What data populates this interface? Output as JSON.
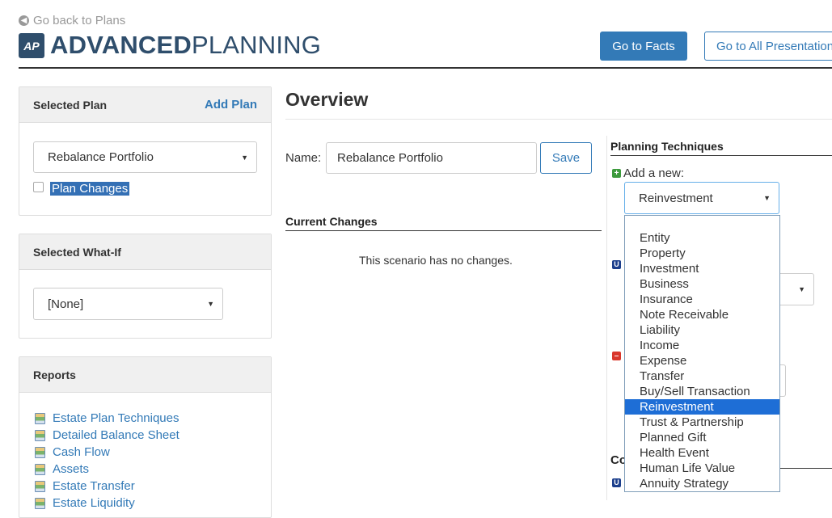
{
  "header": {
    "back_link": "Go back to Plans",
    "logo_text": "AP",
    "brand_bold": "ADVANCED",
    "brand_light": "PLANNING",
    "go_to_facts": "Go to Facts",
    "go_to_all": "Go to All Presentations"
  },
  "sidebar": {
    "selected_plan": {
      "title": "Selected Plan",
      "add_plan": "Add Plan",
      "value": "Rebalance Portfolio",
      "checkbox_label": "Plan Changes"
    },
    "selected_whatif": {
      "title": "Selected What-If",
      "value": "[None]"
    },
    "reports": {
      "title": "Reports",
      "items": [
        "Estate Plan Techniques",
        "Detailed Balance Sheet",
        "Cash Flow",
        "Assets",
        "Estate Transfer",
        "Estate Liquidity"
      ]
    }
  },
  "main": {
    "title": "Overview",
    "name_label": "Name:",
    "name_value": "Rebalance Portfolio",
    "save_label": "Save",
    "current_changes": {
      "title": "Current Changes",
      "empty_text": "This scenario has no changes."
    }
  },
  "planning": {
    "title": "Planning Techniques",
    "add_new_label": "Add a new:",
    "selected_value": "Reinvestment",
    "partial_heading": "Co",
    "options": [
      "Entity",
      "Property",
      "Investment",
      "Business",
      "Insurance",
      "Note Receivable",
      "Liability",
      "Income",
      "Expense",
      "Transfer",
      "Buy/Sell Transaction",
      "Reinvestment",
      "Trust & Partnership",
      "Planned Gift",
      "Health Event",
      "Human Life Value",
      "Annuity Strategy"
    ],
    "highlighted_option": "Reinvestment"
  },
  "colors": {
    "brand": "#2f4e6c",
    "primary": "#337ab7",
    "highlight": "#1e6ed6"
  }
}
